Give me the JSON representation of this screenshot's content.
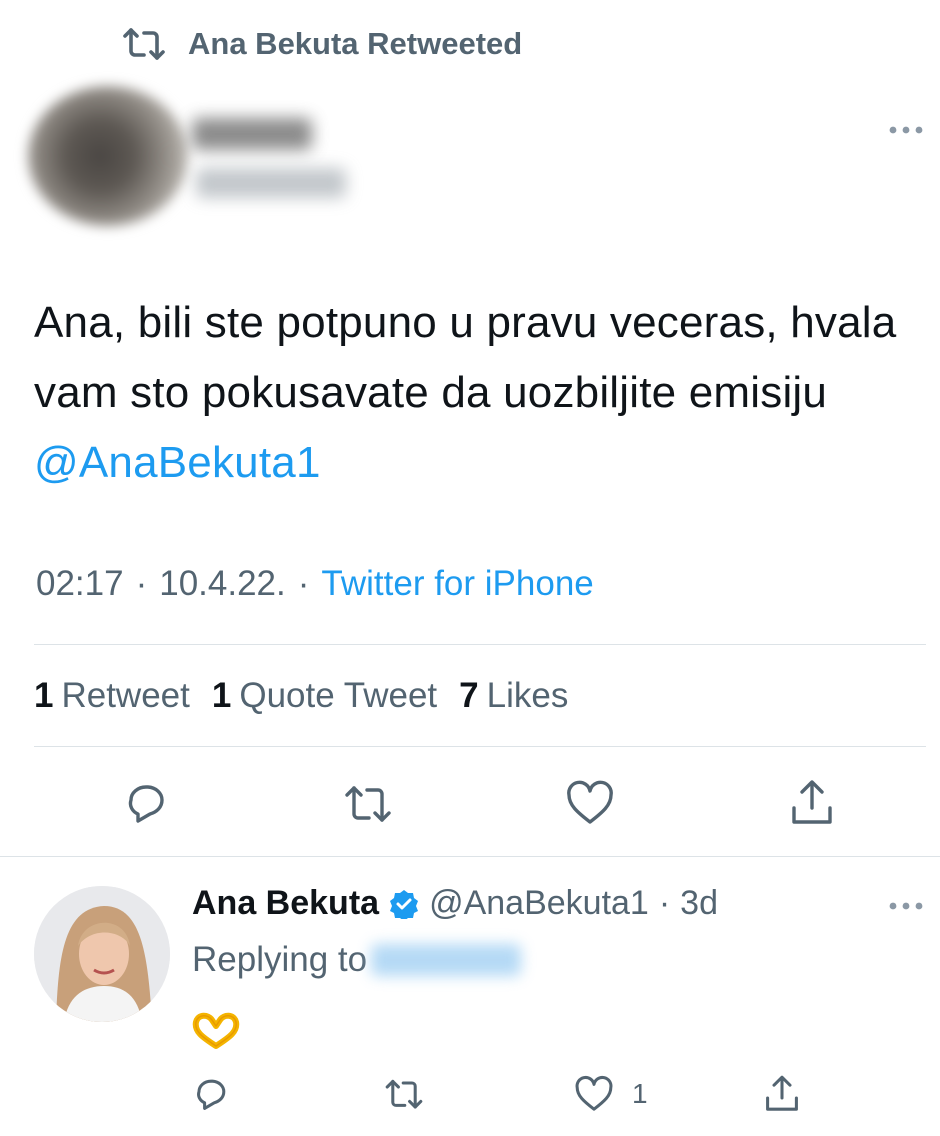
{
  "retweet_header": {
    "text": "Ana Bekuta Retweeted"
  },
  "main_tweet": {
    "text_part1": "Ana, bili ste potpuno u pravu veceras, hvala vam sto pokusavate da uozbiljite emisiju ",
    "mention": "@AnaBekuta1",
    "time": "02:17",
    "dot1": "·",
    "date": "10.4.22.",
    "dot2": "·",
    "source": "Twitter for iPhone",
    "stats": {
      "retweets_count": "1",
      "retweets_label": "Retweet",
      "quotes_count": "1",
      "quotes_label": "Quote Tweet",
      "likes_count": "7",
      "likes_label": "Likes"
    },
    "actions": [
      "reply-icon",
      "retweet-icon",
      "like-icon",
      "share-icon"
    ]
  },
  "reply_tweet": {
    "name": "Ana Bekuta",
    "handle": "@AnaBekuta1",
    "dot": "·",
    "age": "3d",
    "replying_prefix": "Replying to",
    "body_emoji": "heart-hands-emoji",
    "like_count": "1",
    "actions": [
      "reply-icon",
      "retweet-icon",
      "like-icon",
      "share-icon"
    ]
  },
  "colors": {
    "accent": "#1d9bf0",
    "secondary_text": "#536471",
    "primary_text": "#0f1419",
    "divider": "#dde3e7",
    "verified": "#1d9bf0"
  }
}
